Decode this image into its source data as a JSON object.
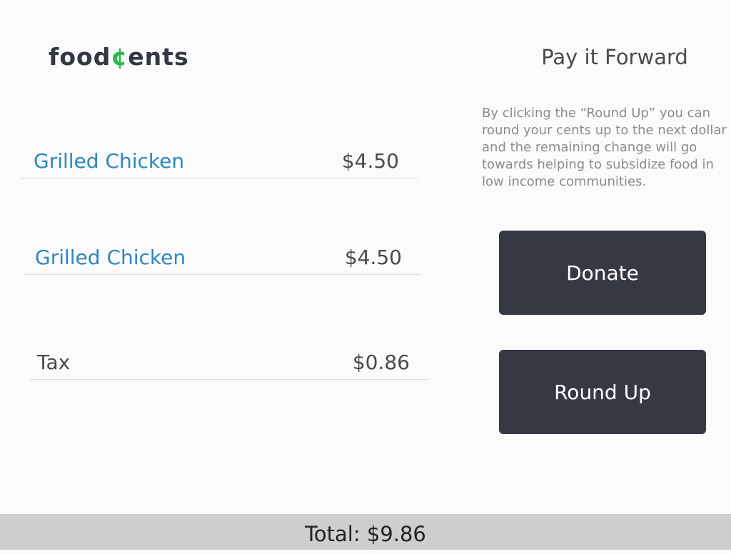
{
  "logo": {
    "part1": "food",
    "cent": "¢",
    "part2": "ents"
  },
  "order": {
    "items": [
      {
        "name": "Grilled Chicken",
        "price": "$4.50"
      },
      {
        "name": "Grilled Chicken",
        "price": "$4.50"
      }
    ],
    "tax": {
      "label": "Tax",
      "amount": "$0.86"
    }
  },
  "pay_it_forward": {
    "title": "Pay it Forward",
    "description": "By clicking the “Round Up” you can round your cents up to the next dollar and the remaining change will go towards helping to subsidize food in low income communities.",
    "donate_label": "Donate",
    "round_up_label": "Round Up"
  },
  "total": {
    "text": "Total: $9.86"
  },
  "colors": {
    "brand_text": "#333842",
    "brand_accent": "#2db84f",
    "item_name": "#2d87c1",
    "button_bg": "#363944",
    "total_bar_bg": "#cdced0"
  }
}
